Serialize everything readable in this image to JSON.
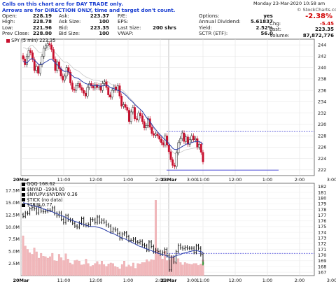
{
  "notice": {
    "line1": "Calls on this chart are for DAY TRADE only.",
    "line2": "Arrows are for DIRECTION ONLY, time and target don't count."
  },
  "datetime": "Monday  23-Mar-2020  10:58 am",
  "watermark": "© StockCharts.com",
  "quote": {
    "open_label": "Open:",
    "open": "228.19",
    "high_label": "High:",
    "high": "228.78",
    "low_label": "Low:",
    "low": "221.96",
    "prev_label": "Prev Close:",
    "prev": "228.80",
    "ask_label": "Ask:",
    "ask": "223.37",
    "asksize_label": "Ask Size:",
    "asksize": "100",
    "bid_label": "Bid:",
    "bid": "223.35",
    "bidsize_label": "Bid Size:",
    "bidsize": "100",
    "pe_label": "P/E:",
    "pe": "",
    "eps_label": "EPS:",
    "eps": "",
    "lastsize_label": "Last Size:",
    "lastsize": "200 shrs",
    "vwap_label": "VWAP:",
    "vwap": "",
    "options_label": "Options:",
    "options": "yes",
    "div_label": "Annual Dividend:",
    "div": "5.61837",
    "yield_label": "Yield:",
    "yield": "2.52%",
    "sctr_label": "SCTR (ETF):",
    "sctr": "56.0",
    "pct": "-2.38%",
    "chg_label": "Chg:",
    "chg": "-5.45",
    "last_label": "Last:",
    "last": "223.35",
    "volume_label": "Volume:",
    "volume": "87,872,776"
  },
  "panel1": {
    "legend": "SPY (5 min) 223.35"
  },
  "panel2": {
    "legend": [
      "QQQ 168.62",
      "$NYAD -1904.00",
      "$NYUPV:$NYDNV 0.36",
      "$TICK (no data)",
      "$TRIN 0.77"
    ]
  },
  "chart_data": [
    {
      "type": "candlestick",
      "symbol": "SPY",
      "interval": "5 min",
      "x_ticks": [
        "20Mar",
        "11:00",
        "12:00",
        "1:00",
        "2:00",
        "3:00",
        "23Mar",
        "11:00",
        "12:00",
        "1:00",
        "2:00",
        "3:00"
      ],
      "ylim": [
        221,
        245
      ],
      "y_ticks": [
        222,
        224,
        226,
        228,
        230,
        232,
        234,
        236,
        238,
        240,
        242,
        244
      ],
      "reference_lines": [
        228.8,
        221.96
      ],
      "series": [
        {
          "name": "SPY",
          "close": [
            241.5,
            240.5,
            242,
            243,
            242.6,
            241.4,
            239.5,
            240.2,
            239,
            240.5,
            242,
            243.4,
            243.8,
            244.2,
            244,
            243.2,
            241.5,
            239.5,
            241,
            239.8,
            238.5,
            237.8,
            238.5,
            240,
            239.2,
            237.3,
            236.2,
            236,
            236.8,
            237.2,
            236.5,
            236,
            235.5,
            235,
            236.5,
            237.2,
            236.8,
            236.4,
            237,
            236.5,
            236.8,
            236,
            237.2,
            237.5,
            236.5,
            235.2,
            234.8,
            236,
            236.6,
            236,
            236.8,
            235,
            233.2,
            233.5,
            233,
            232.5,
            230.5,
            232.2,
            233,
            231,
            230.8,
            232,
            231.5,
            230.5,
            229.4,
            229.8,
            231,
            229.5,
            228.4,
            228.1,
            228.3,
            228,
            227.4,
            226.8,
            226.4,
            228,
            226.4,
            225.2,
            223.8,
            222.8,
            222.6,
            225,
            226.8,
            227.5,
            228.5,
            227,
            227.8,
            226.5,
            227.3,
            228,
            227.3,
            227.5,
            226,
            226.5,
            225.1,
            223.4
          ]
        },
        {
          "name": "moving average",
          "values": [
            241,
            241,
            240.8,
            241.2,
            241.5,
            241.6,
            241.3,
            241,
            240.6,
            240.5,
            240.6,
            240.8,
            241,
            241.2,
            241.4,
            241.5,
            241.2,
            240.8,
            240.5,
            240.2,
            239.8,
            239.5,
            239.3,
            239.4,
            239.2,
            238.9,
            238.6,
            238.3,
            238.2,
            238.1,
            237.9,
            237.6,
            237.4,
            237.2,
            237.1,
            237,
            236.9,
            236.8,
            236.8,
            236.8,
            236.8,
            236.7,
            236.8,
            236.9,
            236.9,
            236.8,
            236.5,
            236.4,
            236.3,
            236.1,
            236,
            235.9,
            235.7,
            235.5,
            235.2,
            234.9,
            234.5,
            234.2,
            233.9,
            233.5,
            233.2,
            232.9,
            232.6,
            232.3,
            231.8,
            231.3,
            230.9,
            230.5,
            230,
            229.5,
            229.1,
            228.7,
            228.3,
            228,
            227.6,
            227.3,
            227,
            226.6,
            226.2,
            225.8,
            225.6,
            225.6,
            225.7,
            225.9,
            226.1,
            226.3,
            226.5,
            226.6,
            226.7,
            226.8,
            226.9,
            227,
            227,
            227,
            226.8,
            226.5
          ]
        }
      ]
    },
    {
      "type": "line",
      "symbol": "QQQ",
      "x_ticks": [
        "20Mar",
        "11:00",
        "12:00",
        "1:00",
        "2:00",
        "3:00",
        "23Mar",
        "11:00",
        "12:00",
        "1:00",
        "2:00",
        "3:00"
      ],
      "y_right_ticks": [
        167,
        168,
        169,
        170,
        171,
        172,
        173,
        174,
        175,
        176,
        177,
        178,
        179,
        180,
        181,
        182
      ],
      "y_left_ticks": [
        "17.5M",
        "15.0M",
        "12.5M",
        "10.0M",
        "7.5M",
        "5.0M",
        "2.5M"
      ],
      "ylim": [
        166.4,
        182.6
      ],
      "volume_lim": [
        0,
        19000000
      ],
      "reference_lines": [
        170.3
      ],
      "series": [
        {
          "name": "QQQ",
          "close": [
            176.8,
            177.4,
            177.3,
            178.1,
            178.4,
            178.1,
            177.4,
            178.4,
            177.7,
            177.6,
            177.7,
            177.9,
            177.9,
            178.3,
            177.3,
            176.9,
            177.4,
            176.3,
            175.7,
            176.9,
            176.2,
            176.1,
            175.6,
            175.1,
            174.9,
            175.6,
            176.4,
            175.3,
            175.2,
            175.4,
            176.3,
            176.2,
            175.7,
            176.7,
            175.8,
            176.1,
            175.8,
            175.3,
            175.1,
            174.1,
            174.6,
            174.4,
            173.8,
            172.9,
            173.7,
            173.9,
            173.2,
            172.6,
            172.6,
            172.8,
            172.3,
            172.2,
            172.4,
            171.8,
            171.6,
            170.9,
            172.3,
            171.5,
            170.6,
            170.9,
            170.6,
            170.2,
            170.5,
            171,
            169.9,
            167.4,
            169.6,
            168.8,
            170.6,
            171.7,
            171.3,
            171.1,
            171.4,
            171.2,
            171.2,
            171.2,
            170.5,
            171.6,
            171.2,
            170.1,
            168.6
          ]
        },
        {
          "name": "moving average",
          "values": [
            179.2,
            179.1,
            179,
            178.8,
            178.7,
            178.6,
            178.5,
            178.4,
            178.3,
            178.1,
            178,
            177.8,
            177.7,
            177.6,
            177.4,
            177.3,
            177.1,
            176.9,
            176.8,
            176.6,
            176.4,
            176.2,
            176.1,
            175.9,
            175.8,
            175.6,
            175.5,
            175.4,
            175.2,
            175.1,
            175,
            175,
            175,
            174.9,
            174.8,
            174.7,
            174.5,
            174.3,
            174.1,
            173.9,
            173.8,
            173.6,
            173.4,
            173.2,
            173,
            172.9,
            172.7,
            172.5,
            172.3,
            172.1,
            171.9,
            171.7,
            171.5,
            171.4,
            171.2,
            171.1,
            170.9,
            170.8,
            170.6,
            170.5,
            170.3,
            170.2,
            170.1,
            170,
            169.8,
            169.6,
            169.6,
            169.7,
            169.9,
            170,
            170.1,
            170.3,
            170.4,
            170.5,
            170.6,
            170.7,
            170.8,
            170.8,
            170.7,
            170.6,
            170.5
          ]
        },
        {
          "name": "volume",
          "values": [
            8200000,
            6100000,
            5400000,
            4700000,
            4400000,
            5700000,
            4900000,
            3600000,
            4600000,
            4000000,
            3900000,
            3600000,
            3900000,
            4600000,
            3100000,
            3000000,
            4400000,
            3700000,
            3100000,
            4500000,
            3400000,
            2600000,
            2300000,
            3100000,
            3200000,
            3000000,
            2200000,
            2300000,
            3400000,
            2500000,
            1900000,
            2100000,
            2500000,
            2900000,
            2300000,
            3000000,
            2300000,
            1900000,
            2400000,
            2600000,
            2500000,
            1900000,
            1700000,
            1400000,
            2300000,
            3000000,
            1800000,
            2200000,
            1900000,
            2600000,
            1500000,
            2500000,
            2400000,
            2700000,
            2700000,
            3300000,
            2900000,
            3300000,
            3200000,
            15500000,
            5100000,
            4100000,
            3400000,
            5000000,
            3100000,
            3200000,
            4100000,
            3800000,
            2700000,
            3500000,
            2700000,
            2200000,
            2700000,
            2500000,
            2400000,
            2300000,
            2500000,
            2500000,
            2100000,
            2400000,
            3200000
          ]
        }
      ]
    }
  ]
}
